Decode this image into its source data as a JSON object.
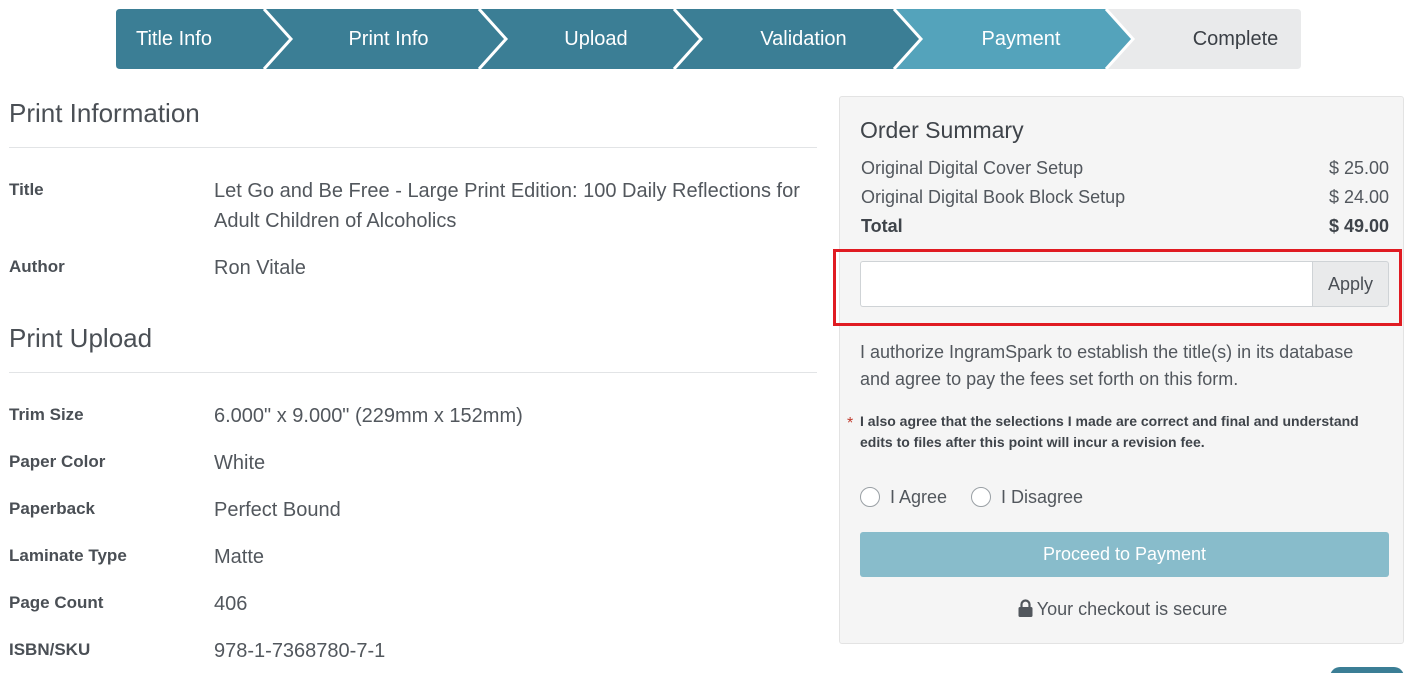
{
  "stepper": {
    "steps": [
      {
        "label": "Title Info",
        "state": "done"
      },
      {
        "label": "Print Info",
        "state": "done"
      },
      {
        "label": "Upload",
        "state": "done"
      },
      {
        "label": "Validation",
        "state": "done"
      },
      {
        "label": "Payment",
        "state": "current"
      },
      {
        "label": "Complete",
        "state": "upcoming"
      }
    ],
    "colors": {
      "done": "#3b7e95",
      "current": "#54a3bb",
      "upcoming": "#e9eaeb",
      "separator": "#ffffff"
    }
  },
  "print_information": {
    "title": "Print Information",
    "rows": [
      {
        "label": "Title",
        "value": "Let Go and Be Free - Large Print Edition: 100 Daily Reflections for Adult Children of Alcoholics"
      },
      {
        "label": "Author",
        "value": "Ron Vitale"
      }
    ]
  },
  "print_upload": {
    "title": "Print Upload",
    "rows": [
      {
        "label": "Trim Size",
        "value": "6.000\" x 9.000\" (229mm x 152mm)"
      },
      {
        "label": "Paper Color",
        "value": "White"
      },
      {
        "label": "Paperback",
        "value": "Perfect Bound"
      },
      {
        "label": "Laminate Type",
        "value": "Matte"
      },
      {
        "label": "Page Count",
        "value": "406"
      },
      {
        "label": "ISBN/SKU",
        "value": "978-1-7368780-7-1"
      }
    ]
  },
  "order_summary": {
    "title": "Order Summary",
    "items": [
      {
        "label": "Original Digital Cover Setup",
        "amount": "$ 25.00"
      },
      {
        "label": "Original Digital Book Block Setup",
        "amount": "$ 24.00"
      }
    ],
    "total": {
      "label": "Total",
      "amount": "$ 49.00"
    },
    "coupon": {
      "value": "",
      "placeholder": "",
      "apply_label": "Apply"
    },
    "authorization_text": "I authorize IngramSpark to establish the title(s) in its database and agree to pay the fees set forth on this form.",
    "required_marker": "*",
    "agreement_text": "I also agree that the selections I made are correct and final and understand edits to files after this point will incur a revision fee.",
    "options": {
      "agree": "I Agree",
      "disagree": "I Disagree"
    },
    "proceed_label": "Proceed to Payment",
    "secure_text": "Your checkout is secure",
    "highlight_color": "#e01b22",
    "proceed_color": "#88bccb"
  }
}
